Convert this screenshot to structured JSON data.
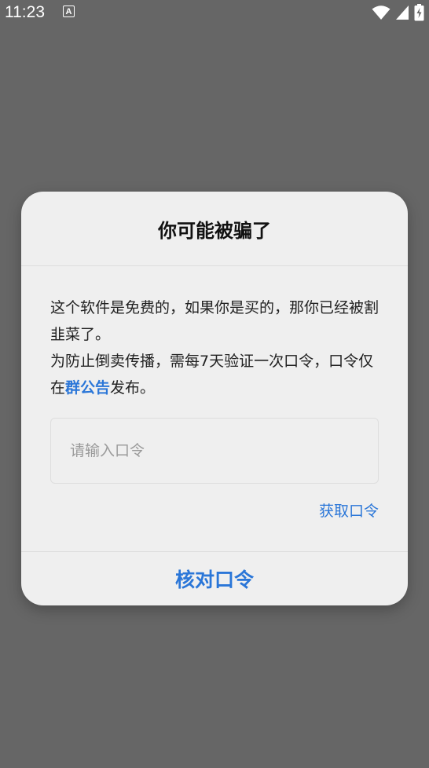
{
  "status_bar": {
    "time": "11:23",
    "notification_icon_letter": "A",
    "icons": [
      "wifi-icon",
      "signal-icon",
      "battery-charging-icon"
    ]
  },
  "dialog": {
    "title": "你可能被骗了",
    "message_line1": "这个软件是免费的，如果你是买的，那你已经被割韭菜了。",
    "message_line2_prefix": "为防止倒卖传播，需每7天验证一次口令，口令仅在",
    "message_link": "群公告",
    "message_line2_suffix": "发布。",
    "input_placeholder": "请输入口令",
    "input_value": "",
    "get_code_label": "获取口令",
    "verify_label": "核对口令"
  },
  "colors": {
    "accent": "#2a76d8",
    "backdrop": "#666666",
    "dialog_bg": "#efefef"
  }
}
